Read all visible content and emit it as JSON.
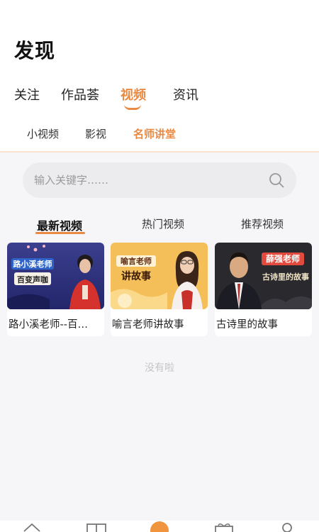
{
  "header": {
    "title": "发现"
  },
  "main_tabs": [
    {
      "label": "关注"
    },
    {
      "label": "作品荟"
    },
    {
      "label": "视频"
    },
    {
      "label": "资讯"
    }
  ],
  "sub_tabs": [
    {
      "label": "小视频"
    },
    {
      "label": "影视"
    },
    {
      "label": "名师讲堂"
    }
  ],
  "search": {
    "placeholder": "输入关键字……",
    "value": ""
  },
  "category_tabs": [
    {
      "label": "最新视频"
    },
    {
      "label": "热门视频"
    },
    {
      "label": "推荐视频"
    }
  ],
  "videos": [
    {
      "title": "路小溪老师--百…",
      "thumb_banner": "路小溪老师",
      "thumb_sub": "百变声咖"
    },
    {
      "title": "喻言老师讲故事",
      "thumb_banner": "喻言老师",
      "thumb_sub": "讲故事"
    },
    {
      "title": "古诗里的故事",
      "thumb_banner": "薛强老师",
      "thumb_sub": "古诗里的故事"
    }
  ],
  "empty_state": "没有啦",
  "colors": {
    "accent": "#e88a43",
    "underline": "#e88a43"
  },
  "bottom_nav": [
    {
      "icon": "home-icon"
    },
    {
      "icon": "book-icon"
    },
    {
      "icon": "discover-icon"
    },
    {
      "icon": "gift-icon"
    },
    {
      "icon": "profile-icon"
    }
  ]
}
